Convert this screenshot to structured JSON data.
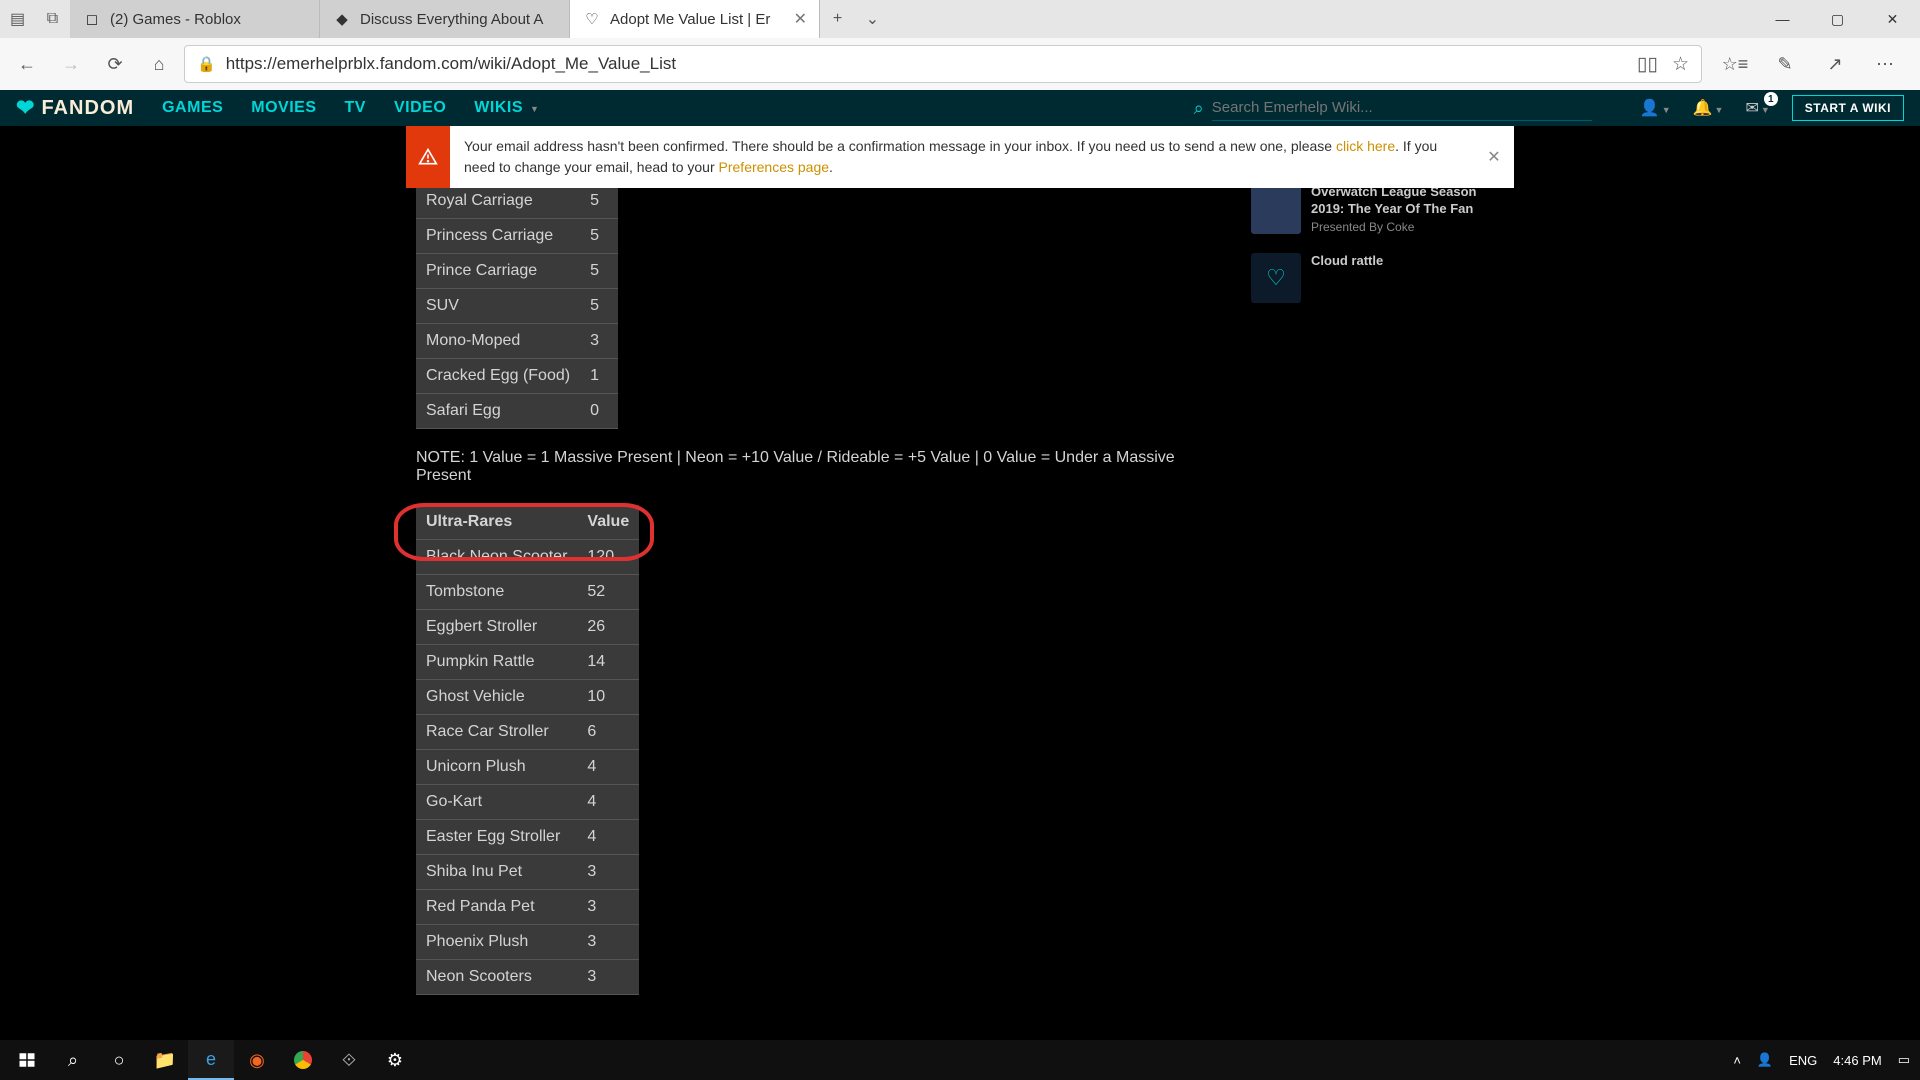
{
  "browser": {
    "tabs": [
      {
        "title": "(2) Games - Roblox"
      },
      {
        "title": "Discuss Everything About A"
      },
      {
        "title": "Adopt Me Value List | Er"
      }
    ],
    "url": "https://emerhelprblx.fandom.com/wiki/Adopt_Me_Value_List"
  },
  "fandom": {
    "brand": "FANDOM",
    "links": [
      "GAMES",
      "MOVIES",
      "TV",
      "VIDEO",
      "WIKIS"
    ],
    "search_placeholder": "Search Emerhelp Wiki...",
    "start_wiki": "START A WIKI",
    "msg_badge": "1"
  },
  "notice": {
    "pre": "Your email address hasn't been confirmed. There should be a confirmation message in your inbox. If you need us to send a new one, please ",
    "link1": "click here",
    "mid": ". If you need to change your email, head to your ",
    "link2": "Preferences page",
    "suffix": "."
  },
  "table_top": {
    "rows": [
      {
        "name": "Royal Carriage",
        "value": "5"
      },
      {
        "name": "Princess Carriage",
        "value": "5"
      },
      {
        "name": "Prince Carriage",
        "value": "5"
      },
      {
        "name": "SUV",
        "value": "5"
      },
      {
        "name": "Mono-Moped",
        "value": "3"
      },
      {
        "name": "Cracked Egg (Food)",
        "value": "1"
      },
      {
        "name": "Safari Egg",
        "value": "0"
      }
    ]
  },
  "note": "NOTE: 1 Value = 1 Massive Present | Neon = +10 Value / Rideable = +5 Value | 0 Value = Under a Massive Present",
  "table_ultra": {
    "header_name": "Ultra-Rares",
    "header_value": "Value",
    "rows": [
      {
        "name": "Black Neon Scooter",
        "value": "120"
      },
      {
        "name": "Tombstone",
        "value": "52"
      },
      {
        "name": "Eggbert Stroller",
        "value": "26"
      },
      {
        "name": "Pumpkin Rattle",
        "value": "14"
      },
      {
        "name": "Ghost Vehicle",
        "value": "10"
      },
      {
        "name": "Race Car Stroller",
        "value": "6"
      },
      {
        "name": "Unicorn Plush",
        "value": "4"
      },
      {
        "name": "Go-Kart",
        "value": "4"
      },
      {
        "name": "Easter Egg Stroller",
        "value": "4"
      },
      {
        "name": "Shiba Inu Pet",
        "value": "3"
      },
      {
        "name": "Red Panda Pet",
        "value": "3"
      },
      {
        "name": "Phoenix Plush",
        "value": "3"
      },
      {
        "name": "Neon Scooters",
        "value": "3"
      }
    ]
  },
  "sidebar": {
    "items": [
      {
        "title": "Overwatch League Season 2019: The Year Of The Fan",
        "sub": "Presented By Coke"
      },
      {
        "title": "Cloud rattle",
        "sub": ""
      }
    ]
  },
  "taskbar": {
    "lang": "ENG",
    "time": "4:46 PM"
  }
}
